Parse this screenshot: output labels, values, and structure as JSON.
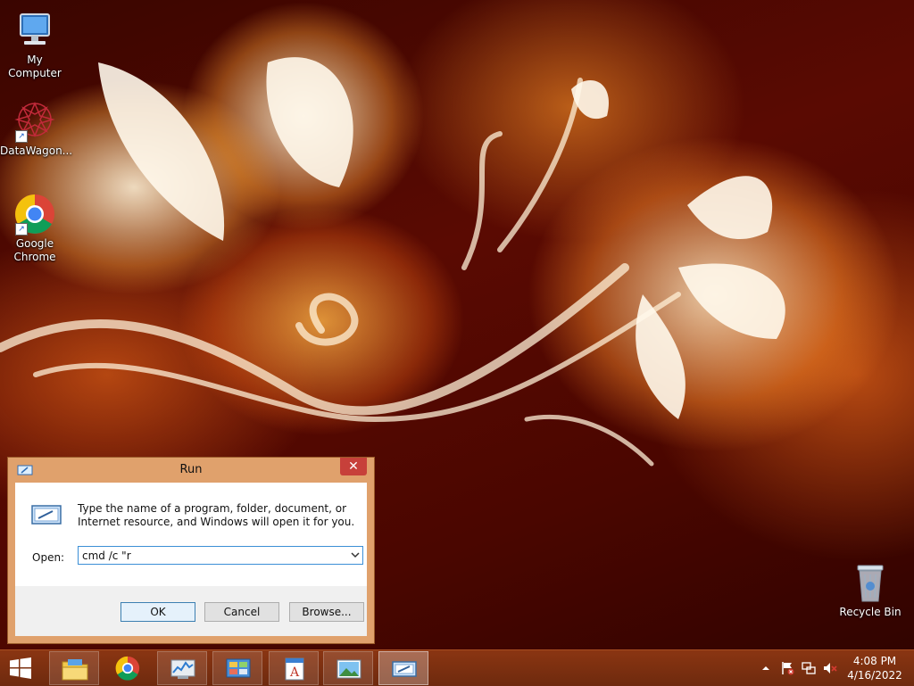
{
  "desktop": {
    "icons": [
      {
        "label": "My Computer"
      },
      {
        "label": "DataWagon..."
      },
      {
        "label": "Google Chrome"
      }
    ],
    "recycle_bin": {
      "label": "Recycle Bin"
    }
  },
  "run_dialog": {
    "title": "Run",
    "close_glyph": "✕",
    "prompt": "Type the name of a program, folder, document, or Internet resource, and Windows will open it for you.",
    "open_label": "Open:",
    "open_value": "cmd /c \"r",
    "buttons": {
      "ok": "OK",
      "cancel": "Cancel",
      "browse": "Browse..."
    }
  },
  "taskbar": {
    "items": [
      {
        "icon": "file-explorer-icon"
      },
      {
        "icon": "chrome-icon"
      },
      {
        "icon": "resource-monitor-icon"
      },
      {
        "icon": "control-panel-icon"
      },
      {
        "icon": "wordpad-icon"
      },
      {
        "icon": "image-viewer-icon"
      },
      {
        "icon": "run-icon"
      }
    ],
    "tray": {
      "icons": [
        "show-hidden-icons-chevron",
        "action-center-flag-icon",
        "network-icon",
        "volume-muted-icon"
      ],
      "time": "4:08 PM",
      "date": "4/16/2022"
    }
  },
  "colors": {
    "titlebar": "#e0a16c",
    "taskbar": "#7a2f10",
    "close_button": "#c7403a",
    "input_focus": "#3b8fd6"
  }
}
